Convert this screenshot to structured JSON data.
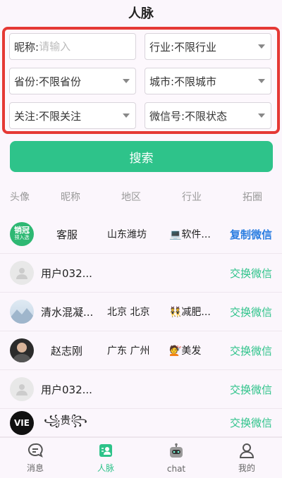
{
  "header": {
    "title": "人脉"
  },
  "filters": {
    "nickname_label": "昵称:",
    "nickname_placeholder": "请输入",
    "industry": "行业:不限行业",
    "province": "省份:不限省份",
    "city": "城市:不限城市",
    "follow": "关注:不限关注",
    "wechat": "微信号:不限状态"
  },
  "search_label": "搜索",
  "columns": [
    "头像",
    "昵称",
    "地区",
    "行业",
    "拓圈"
  ],
  "rows": [
    {
      "avatar_text": "销冠",
      "avatar_sub": "预入选",
      "nickname": "客服",
      "region": "山东潍坊",
      "industry": "💻软件...",
      "action": "复制微信"
    },
    {
      "nickname": "用户032...",
      "region": "",
      "industry": "",
      "action": "交换微信"
    },
    {
      "nickname": "清水混凝...",
      "region": "北京 北京",
      "industry": "👯减肥...",
      "action": "交换微信"
    },
    {
      "nickname": "赵志刚",
      "region": "广东 广州",
      "industry": "💇美发",
      "action": "交换微信"
    },
    {
      "nickname": "用户032...",
      "region": "",
      "industry": "",
      "action": "交换微信"
    },
    {
      "avatar_text": "VIE",
      "nickname": "꧁贵꧂",
      "region": "",
      "industry": "",
      "action": "交换微信"
    }
  ],
  "tabs": [
    {
      "label": "消息",
      "icon": "message-icon"
    },
    {
      "label": "人脉",
      "icon": "contacts-icon"
    },
    {
      "label": "chat",
      "icon": "robot-icon"
    },
    {
      "label": "我的",
      "icon": "profile-icon"
    }
  ],
  "colors": {
    "accent": "#2ec38a",
    "highlight": "#e53935",
    "copy_link": "#2a7de1"
  }
}
